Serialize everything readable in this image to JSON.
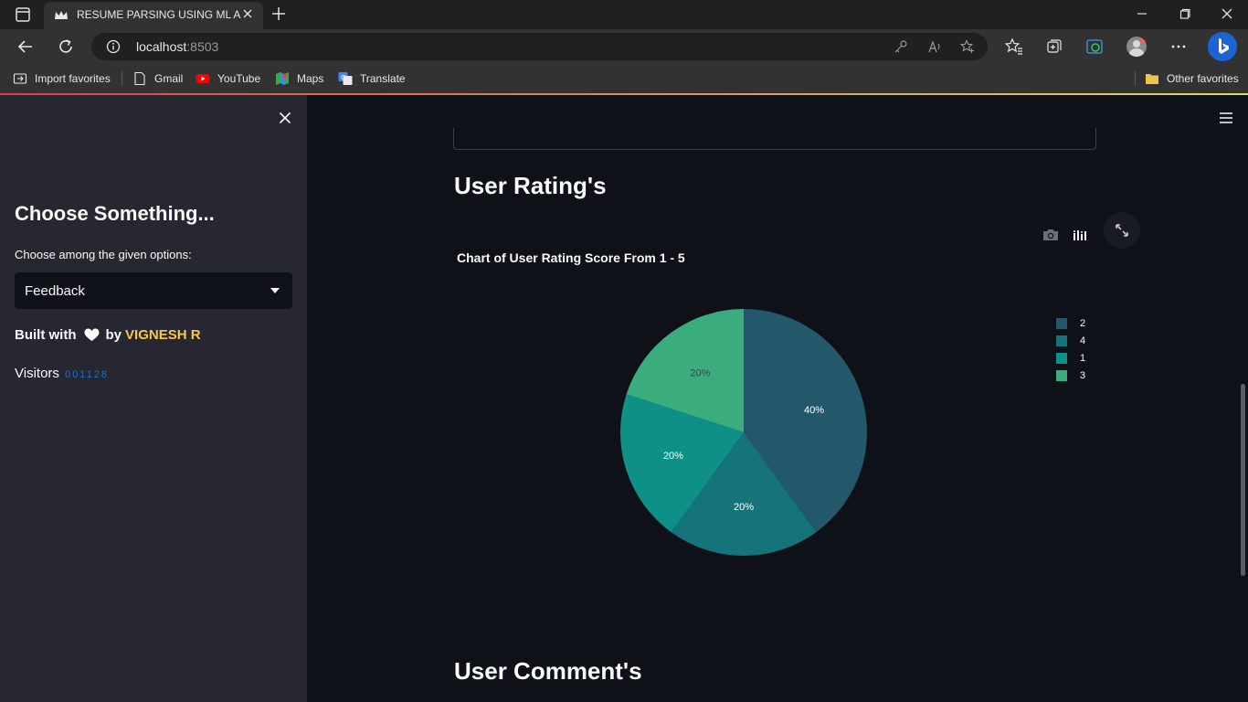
{
  "browser": {
    "tab_title": "RESUME PARSING USING ML AN",
    "url_host": "localhost",
    "url_port": ":8503",
    "favorites": [
      {
        "label": "Import favorites",
        "icon": "import-icon"
      },
      {
        "label": "Gmail",
        "icon": "page-icon"
      },
      {
        "label": "YouTube",
        "icon": "youtube-icon"
      },
      {
        "label": "Maps",
        "icon": "maps-icon"
      },
      {
        "label": "Translate",
        "icon": "translate-icon"
      }
    ],
    "other_favorites": "Other favorites"
  },
  "sidebar": {
    "title": "Choose Something...",
    "select_label": "Choose among the given options:",
    "select_value": "Feedback",
    "built_with": "Built with",
    "by": "by",
    "author": "VIGNESH R",
    "visitors_label": "Visitors",
    "visitors_count": "001128"
  },
  "main": {
    "rating_heading": "User Rating's",
    "comment_heading": "User Comment's"
  },
  "chart_data": {
    "type": "pie",
    "title": "Chart of User Rating Score From 1 - 5",
    "slices": [
      {
        "label": "2",
        "value": 40,
        "text": "40%",
        "color": "#23586a"
      },
      {
        "label": "4",
        "value": 20,
        "text": "20%",
        "color": "#147479"
      },
      {
        "label": "1",
        "value": 20,
        "text": "20%",
        "color": "#0f9086"
      },
      {
        "label": "3",
        "value": 20,
        "text": "20%",
        "color": "#3aac7e"
      }
    ],
    "legend_position": "top-right",
    "direction": "clockwise",
    "start": "top"
  }
}
